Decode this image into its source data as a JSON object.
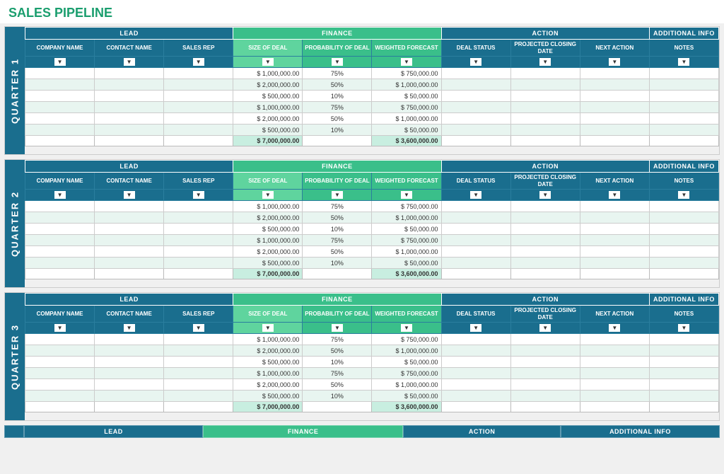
{
  "title": "SALES PIPELINE",
  "groups": {
    "lead": "LEAD",
    "finance": "FINANCE",
    "action": "ACTION",
    "additional": "ADDITIONAL INFO"
  },
  "columns": {
    "company": "COMPANY NAME",
    "contact": "CONTACT NAME",
    "salesrep": "SALES REP",
    "sizedeal": "SIZE OF DEAL",
    "probdeal": "PROBABILITY OF DEAL",
    "weighted": "WEIGHTED FORECAST",
    "dealstatus": "DEAL STATUS",
    "projclose": "PROJECTED CLOSING DATE",
    "nextaction": "NEXT ACTION",
    "notes": "NOTES"
  },
  "quarters": [
    {
      "label": "QUARTER 1"
    },
    {
      "label": "QUARTER 2"
    },
    {
      "label": "QUARTER 3"
    }
  ],
  "rows": [
    {
      "size": "1,000,000.00",
      "prob": "75%",
      "weighted": "750,000.00"
    },
    {
      "size": "2,000,000.00",
      "prob": "50%",
      "weighted": "1,000,000.00"
    },
    {
      "size": "500,000.00",
      "prob": "10%",
      "weighted": "50,000.00"
    },
    {
      "size": "1,000,000.00",
      "prob": "75%",
      "weighted": "750,000.00"
    },
    {
      "size": "2,000,000.00",
      "prob": "50%",
      "weighted": "1,000,000.00"
    },
    {
      "size": "500,000.00",
      "prob": "10%",
      "weighted": "50,000.00"
    }
  ],
  "total": {
    "size": "7,000,000.00",
    "weighted": "3,600,000.00"
  },
  "bottom_bar": {
    "lead": "LEAD",
    "finance": "FINANCE",
    "action": "ACTION",
    "additional": "ADDITIONAL INFO"
  }
}
